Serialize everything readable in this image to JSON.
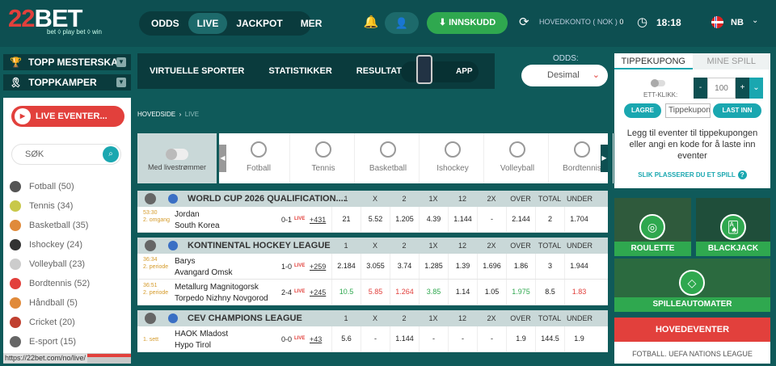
{
  "header": {
    "logo": {
      "brand": "22BET",
      "tagline": "bet ◊ play bet ◊ win"
    },
    "nav": [
      {
        "label": "ODDS",
        "active": false
      },
      {
        "label": "LIVE",
        "active": true
      },
      {
        "label": "JACKPOT",
        "active": false
      },
      {
        "label": "MER",
        "active": false
      }
    ],
    "deposit_label": "INNSKUDD",
    "balance_label": "HOVEDKONTO ( NOK )",
    "balance_value": "0",
    "time": "18:18",
    "language": "NB"
  },
  "left": {
    "top_championships": "TOPP MESTERSKAP",
    "top_matches": "TOPPKAMPER",
    "live_events_button": "LIVE EVENTER...",
    "search_placeholder": "SØK",
    "sports": [
      {
        "label": "Fotball (50)",
        "color": "#555555"
      },
      {
        "label": "Tennis (34)",
        "color": "#c8c84a"
      },
      {
        "label": "Basketball (35)",
        "color": "#e08a3a"
      },
      {
        "label": "Ishockey (24)",
        "color": "#333333"
      },
      {
        "label": "Volleyball (23)",
        "color": "#cccccc"
      },
      {
        "label": "Bordtennis (52)",
        "color": "#e2403c"
      },
      {
        "label": "Håndball (5)",
        "color": "#e08a3a"
      },
      {
        "label": "Cricket (20)",
        "color": "#c04030"
      },
      {
        "label": "E-sport (15)",
        "color": "#666666"
      }
    ],
    "url_text": "https://22bet.com/no/live/"
  },
  "center": {
    "top_tabs": [
      "VIRTUELLE SPORTER",
      "STATISTIKKER",
      "RESULTATER"
    ],
    "app_label": "APP",
    "odds_label": "ODDS:",
    "odds_value": "Desimal",
    "breadcrumb": {
      "home": "HOVEDSIDE",
      "current": "LIVE"
    },
    "stream_label": "Med livestrømmer",
    "sports_strip": [
      "Fotball",
      "Tennis",
      "Basketball",
      "Ishockey",
      "Volleyball",
      "Bordtennis"
    ],
    "columns": [
      "1",
      "X",
      "2",
      "1X",
      "12",
      "2X",
      "OVER",
      "TOTAL",
      "UNDER"
    ],
    "groups": [
      {
        "title": "WORLD CUP 2026 QUALIFICATION....",
        "events": [
          {
            "time": "53:30",
            "period": "2. omgang",
            "team1": "Jordan",
            "team2": "South Korea",
            "score": "0-1",
            "live": "LIVE",
            "more": "+431",
            "odds": [
              "21",
              "5.52",
              "1.205",
              "4.39",
              "1.144",
              "-",
              "2.144",
              "2",
              "1.704"
            ],
            "trend": [
              "",
              "",
              "",
              "",
              "",
              "",
              "",
              "",
              ""
            ]
          }
        ]
      },
      {
        "title": "KONTINENTAL HOCKEY LEAGUE",
        "events": [
          {
            "time": "36:34",
            "period": "2. periode",
            "team1": "Barys",
            "team2": "Avangard Omsk",
            "score": "1-0",
            "live": "LIVE",
            "more": "+259",
            "odds": [
              "2.184",
              "3.055",
              "3.74",
              "1.285",
              "1.39",
              "1.696",
              "1.86",
              "3",
              "1.944"
            ],
            "trend": [
              "",
              "",
              "",
              "",
              "",
              "",
              "",
              "",
              ""
            ]
          },
          {
            "time": "36:51",
            "period": "2. periode",
            "team1": "Metallurg Magnitogorsk",
            "team2": "Torpedo Nizhny Novgorod",
            "score": "2-4",
            "live": "LIVE",
            "more": "+245",
            "odds": [
              "10.5",
              "5.85",
              "1.264",
              "3.85",
              "1.14",
              "1.05",
              "1.975",
              "8.5",
              "1.83"
            ],
            "trend": [
              "up",
              "dn",
              "dn",
              "up",
              "",
              "",
              "up",
              "",
              "dn"
            ]
          }
        ]
      },
      {
        "title": "CEV CHAMPIONS LEAGUE",
        "events": [
          {
            "time": "",
            "period": "1. sett",
            "team1": "HAOK Mladost",
            "team2": "Hypo Tirol",
            "score": "0-0",
            "live": "LIVE",
            "more": "+43",
            "odds": [
              "5.6",
              "-",
              "1.144",
              "-",
              "-",
              "-",
              "1.9",
              "144.5",
              "1.9"
            ],
            "trend": [
              "",
              "",
              "",
              "",
              "",
              "",
              "",
              "",
              ""
            ]
          }
        ]
      }
    ]
  },
  "right": {
    "coupon_tab": "TIPPEKUPONG",
    "my_bets_tab": "MINE SPILL",
    "one_click": "ETT-KLIKK:",
    "stake_value": "100",
    "save_label": "LAGRE",
    "code_placeholder": "Tippekupong",
    "load_label": "LAST INN",
    "message": "Legg til eventer til tippekupongen eller angi en kode for å laste inn eventer",
    "help_link": "SLIK PLASSERER DU ET SPILL",
    "games": [
      "ROULETTE",
      "BLACKJACK",
      "SPILLEAUTOMATER"
    ],
    "main_events": "HOVEDEVENTER",
    "main_events_sub": "FOTBALL. UEFA NATIONS LEAGUE"
  }
}
